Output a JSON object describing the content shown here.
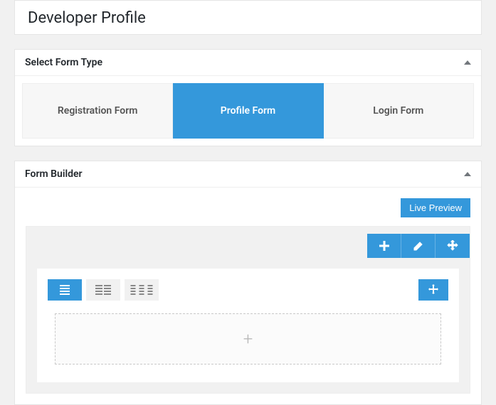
{
  "page": {
    "title": "Developer Profile"
  },
  "form_type_panel": {
    "heading": "Select Form Type",
    "tabs": [
      {
        "label": "Registration Form",
        "active": false
      },
      {
        "label": "Profile Form",
        "active": true
      },
      {
        "label": "Login Form",
        "active": false
      }
    ]
  },
  "builder_panel": {
    "heading": "Form Builder",
    "live_preview_label": "Live Preview"
  },
  "colors": {
    "accent": "#3498db",
    "canvas_bg": "#f1f1f1"
  }
}
